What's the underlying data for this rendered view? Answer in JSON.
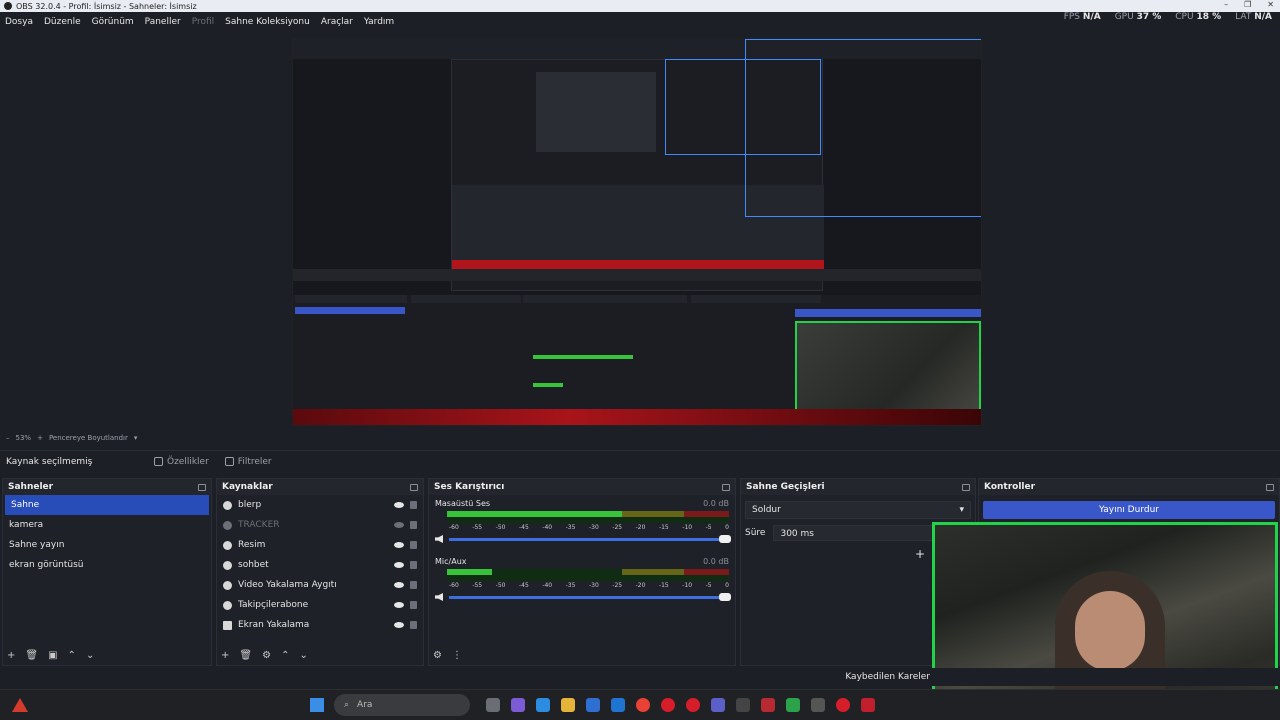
{
  "window": {
    "title": "OBS 32.0.4 - Profil: İsimsiz - Sahneler: İsimsiz",
    "controls": [
      "–",
      "❐",
      "✕"
    ]
  },
  "menu": {
    "items": [
      "Dosya",
      "Düzenle",
      "Görünüm",
      "Paneller",
      "Profil",
      "Sahne Koleksiyonu",
      "Araçlar",
      "Yardım"
    ],
    "disabled_index": 4
  },
  "stats": {
    "fps_label": "FPS",
    "fps": "N/A",
    "gpu_label": "GPU",
    "gpu": "37 %",
    "cpu_label": "CPU",
    "cpu": "18 %",
    "lat_label": "LAT",
    "lat": "N/A"
  },
  "zoom": {
    "value": "53%",
    "fit_label": "Pencereye Boyutlandır"
  },
  "context": {
    "no_source": "Kaynak seçilmemiş",
    "properties": "Özellikler",
    "filters": "Filtreler"
  },
  "scenes": {
    "title": "Sahneler",
    "items": [
      "Sahne",
      "kamera",
      "Sahne yayın",
      "ekran görüntüsü"
    ],
    "selected": 0
  },
  "sources": {
    "title": "Kaynaklar",
    "items": [
      {
        "name": "blerp",
        "visible": true
      },
      {
        "name": "TRACKER",
        "visible": false
      },
      {
        "name": "Resim",
        "visible": true
      },
      {
        "name": "sohbet",
        "visible": true
      },
      {
        "name": "Video Yakalama Aygıtı",
        "visible": true
      },
      {
        "name": "Takipçilerabone",
        "visible": true
      },
      {
        "name": "Ekran Yakalama",
        "visible": true
      }
    ]
  },
  "mixer": {
    "title": "Ses Karıştırıcı",
    "channels": [
      {
        "name": "Masaüstü Ses",
        "db": "0.0 dB",
        "level": 0.62
      },
      {
        "name": "Mic/Aux",
        "db": "0.0 dB",
        "level": 0.16
      }
    ],
    "ticks": [
      "-60",
      "-55",
      "-50",
      "-45",
      "-40",
      "-35",
      "-30",
      "-25",
      "-20",
      "-15",
      "-10",
      "-5",
      "0"
    ]
  },
  "transitions": {
    "title": "Sahne Geçişleri",
    "selected": "Soldur",
    "duration_label": "Süre",
    "duration": "300 ms"
  },
  "controls": {
    "title": "Kontroller",
    "stream_button": "Yayını Durdur"
  },
  "status": {
    "dropped_frames": "Kaybedilen Kareler"
  },
  "taskbar": {
    "search_placeholder": "Ara"
  },
  "colors": {
    "accent": "#3957c9",
    "meter_green": "#37c43a",
    "selection_blue": "#3d8cff",
    "webcam_border": "#22d34a"
  }
}
